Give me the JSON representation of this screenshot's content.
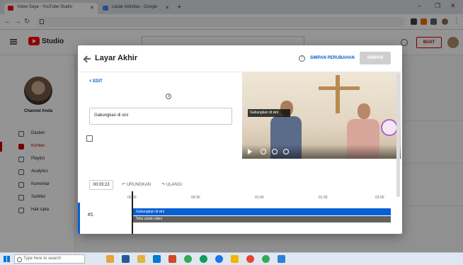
{
  "browser": {
    "tabs": [
      {
        "title": "Video Saya - YouTube Studio"
      },
      {
        "title": "Lacak Aktivitas - Google"
      }
    ]
  },
  "studio": {
    "logo_text": "Studio",
    "create_label": "BUAT",
    "channel_name": "Channel Anda",
    "sidebar_items": [
      {
        "label": "Dasbor"
      },
      {
        "label": "Konten"
      },
      {
        "label": "Playlist"
      },
      {
        "label": "Analytics"
      },
      {
        "label": "Komentar"
      },
      {
        "label": "Subtitel"
      },
      {
        "label": "Hak cipta"
      }
    ]
  },
  "modal": {
    "title": "Layar Akhir",
    "draft_label": "SIMPAN PERUBAHAN",
    "publish_label": "SIMPAN",
    "edit_link": "< EDIT",
    "time_label": "00:03:22",
    "undo_label": "URUNGKAN",
    "redo_label": "ULANGI",
    "caption_text": "Gabungkan di sini",
    "ruler_ticks": [
      "00:00",
      "00:30",
      "01:00",
      "01:30",
      "02:00"
    ],
    "track_1_num": "#1",
    "clip_1_text": "Gabungkan di sini",
    "clip_2_text": "Teks untuk video"
  },
  "video": {
    "caption_text": "Gabungkan di sini"
  },
  "taskbar": {
    "search_placeholder": "Type here to search"
  }
}
